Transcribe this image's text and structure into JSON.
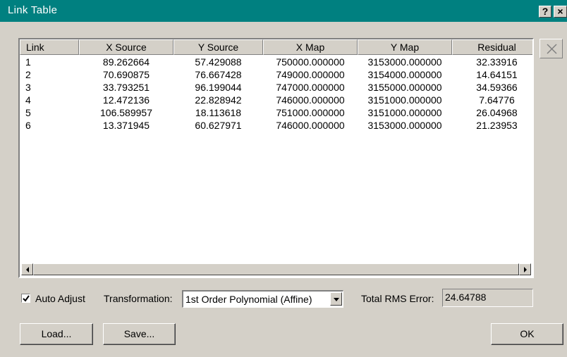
{
  "window": {
    "title": "Link Table",
    "help_label": "?",
    "close_label": "×"
  },
  "table": {
    "columns": [
      "Link",
      "X Source",
      "Y Source",
      "X Map",
      "Y Map",
      "Residual"
    ],
    "rows": [
      [
        "1",
        "89.262664",
        "57.429088",
        "750000.000000",
        "3153000.000000",
        "32.33916"
      ],
      [
        "2",
        "70.690875",
        "76.667428",
        "749000.000000",
        "3154000.000000",
        "14.64151"
      ],
      [
        "3",
        "33.793251",
        "96.199044",
        "747000.000000",
        "3155000.000000",
        "34.59366"
      ],
      [
        "4",
        "12.472136",
        "22.828942",
        "746000.000000",
        "3151000.000000",
        "7.64776"
      ],
      [
        "5",
        "106.589957",
        "18.113618",
        "751000.000000",
        "3151000.000000",
        "26.04968"
      ],
      [
        "6",
        "13.371945",
        "60.627971",
        "746000.000000",
        "3153000.000000",
        "21.23953"
      ]
    ]
  },
  "controls": {
    "auto_adjust_label": "Auto Adjust",
    "auto_adjust_checked": true,
    "transformation_label": "Transformation:",
    "transformation_value": "1st Order Polynomial (Affine)",
    "rms_label": "Total RMS Error:",
    "rms_value": "24.64788"
  },
  "buttons": {
    "load": "Load...",
    "save": "Save...",
    "ok": "OK"
  },
  "icons": {
    "delete_link": "delete-link-icon",
    "checkmark": "checkmark-icon",
    "dropdown_arrow": "chevron-down-icon",
    "scroll_left": "scroll-left-arrow-icon",
    "scroll_right": "scroll-right-arrow-icon"
  }
}
